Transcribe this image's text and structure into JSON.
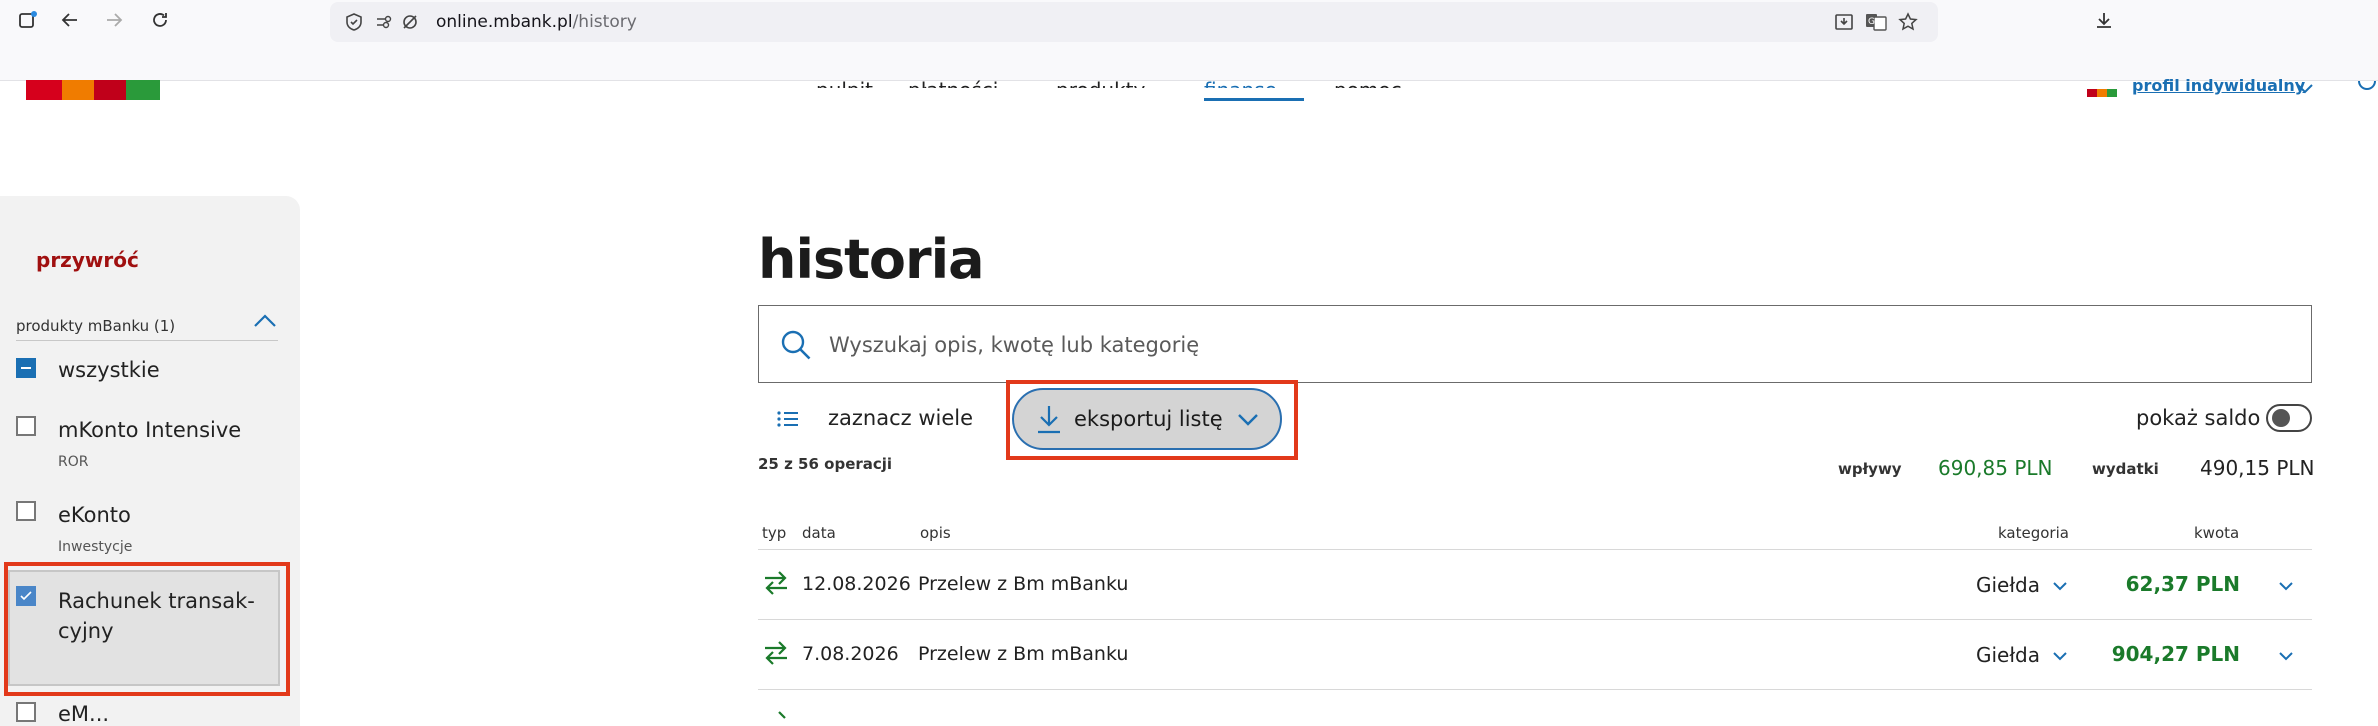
{
  "browser": {
    "url_domain": "online.mbank.pl",
    "url_path": "/history"
  },
  "site_nav": {
    "items": [
      "pulpit",
      "płatności",
      "produkty",
      "finanse",
      "pomoc"
    ],
    "profile": "profil indywidualny"
  },
  "sidebar": {
    "restore_label": "przywróć",
    "section_label": "produkty mBanku (1)",
    "items": [
      {
        "title": "wszystkie",
        "subtitle": "",
        "state": "indeterminate"
      },
      {
        "title": "mKonto Intensive",
        "subtitle": "ROR",
        "state": "unchecked"
      },
      {
        "title": "eKonto",
        "subtitle": "Inwestycje",
        "state": "unchecked"
      },
      {
        "title_line1": "Rachunek transak-",
        "title_line2": "cyjny",
        "state": "checked"
      },
      {
        "title": "eM...",
        "state": "unchecked"
      }
    ]
  },
  "main": {
    "title": "historia",
    "search_placeholder": "Wyszukaj opis, kwotę lub kategorię",
    "select_many_label": "zaznacz wiele",
    "export_label": "eksportuj listę",
    "show_balance_label": "pokaż saldo",
    "ops_count": "25 z 56 operacji",
    "income_label": "wpływy",
    "income_value": "690,85 PLN",
    "expense_label": "wydatki",
    "expense_value": "490,15 PLN",
    "columns": {
      "type": "typ",
      "date": "data",
      "desc": "opis",
      "category": "kategoria",
      "amount": "kwota"
    },
    "rows": [
      {
        "date": "12.08.2026",
        "desc": "Przelew z Bm mBanku",
        "category": "Giełda",
        "amount": "62,37 PLN"
      },
      {
        "date": "7.08.2026",
        "desc": "Przelew z Bm mBanku",
        "category": "Giełda",
        "amount": "904,27 PLN"
      }
    ]
  },
  "colors": {
    "accent": "#1a6fb3",
    "income": "#1a7a2a",
    "brand_red": "#a01010",
    "highlight": "#e2391a"
  }
}
